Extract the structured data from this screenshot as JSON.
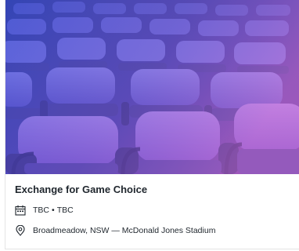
{
  "event": {
    "title": "Exchange for Game Choice",
    "date": "TBC",
    "separator": "•",
    "time": "TBC",
    "location": "Broadmeadow, NSW — McDonald Jones Stadium"
  },
  "icons": {
    "date": "calendar-icon",
    "location": "location-pin-icon"
  },
  "colors": {
    "overlay_left": "#3f4fd8",
    "overlay_right": "#c46ad6",
    "text": "#1f262d"
  }
}
